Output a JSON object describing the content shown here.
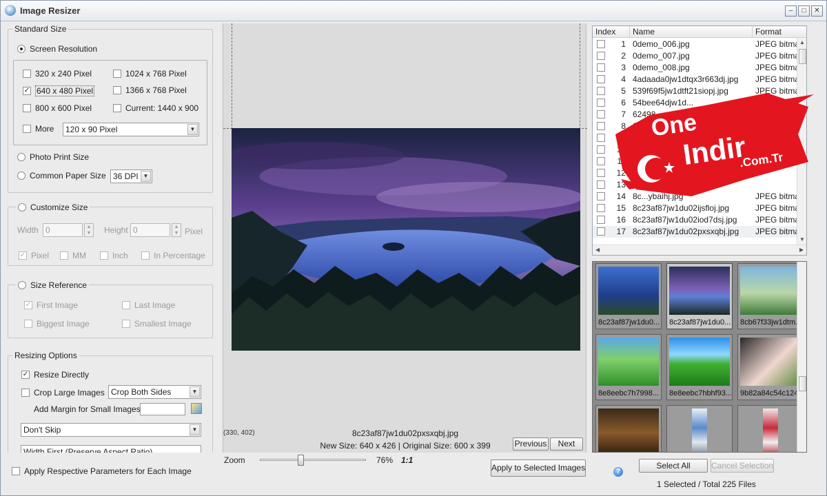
{
  "window": {
    "title": "Image Resizer",
    "controls": [
      "minimize-icon",
      "maximize-icon",
      "close-icon"
    ]
  },
  "standard_size": {
    "title": "Standard Size",
    "screen_resolution": {
      "label": "Screen Resolution",
      "selected": true
    },
    "options": [
      {
        "label": "320 x 240 Pixel",
        "checked": false
      },
      {
        "label": "1024 x 768 Pixel",
        "checked": false
      },
      {
        "label": "640 x 480 Pixel",
        "checked": true
      },
      {
        "label": "1366 x 768 Pixel",
        "checked": false
      },
      {
        "label": "800 x 600 Pixel",
        "checked": false
      },
      {
        "label": "Current: 1440 x 900",
        "checked": false
      }
    ],
    "more": {
      "label": "More",
      "checked": false,
      "value": "120 x 90 Pixel"
    },
    "photo_print": {
      "label": "Photo Print Size",
      "selected": false
    },
    "common_paper": {
      "label": "Common Paper Size",
      "selected": false,
      "dpi": "36 DPI"
    }
  },
  "customize_size": {
    "title": "Customize Size",
    "width_label": "Width",
    "width_value": "0",
    "height_label": "Height",
    "height_value": "0",
    "unit_label": "Pixel",
    "units": [
      {
        "label": "Pixel",
        "checked": true
      },
      {
        "label": "MM",
        "checked": false
      },
      {
        "label": "Inch",
        "checked": false
      },
      {
        "label": "In Percentage",
        "checked": false
      }
    ]
  },
  "size_reference": {
    "title": "Size Reference",
    "options": [
      {
        "label": "First Image",
        "checked": true
      },
      {
        "label": "Last Image",
        "checked": false
      },
      {
        "label": "Biggest Image",
        "checked": false
      },
      {
        "label": "Smallest Image",
        "checked": false
      }
    ]
  },
  "resizing_options": {
    "title": "Resizing Options",
    "resize_directly": {
      "label": "Resize Directly",
      "checked": true
    },
    "crop_large": {
      "label": "Crop Large Images",
      "checked": false,
      "mode": "Crop Both Sides"
    },
    "add_margin_label": "Add Margin for Small Images",
    "skip_mode": "Don't Skip",
    "aspect_mode": "Width First (Preserve Aspect Ratio)"
  },
  "apply_respective": {
    "label": "Apply Respective Parameters for Each Image",
    "checked": false
  },
  "preview": {
    "coords": "(330, 402)",
    "filename": "8c23af87jw1du02pxsxqbj.jpg",
    "size_info": "New Size: 640 x 426 |  Original Size: 600 x 399",
    "previous_label": "Previous",
    "next_label": "Next",
    "zoom_label": "Zoom",
    "zoom_percent": "76%",
    "zoom_value": 0.38,
    "one_to_one": "1:1",
    "apply_label": "Apply to Selected Images"
  },
  "file_list": {
    "columns": [
      "Index",
      "Name",
      "Format"
    ],
    "rows": [
      {
        "index": "1",
        "name": "0demo_006.jpg",
        "format": "JPEG bitma..."
      },
      {
        "index": "2",
        "name": "0demo_007.jpg",
        "format": "JPEG bitma..."
      },
      {
        "index": "3",
        "name": "0demo_008.jpg",
        "format": "JPEG bitma..."
      },
      {
        "index": "4",
        "name": "4adaada0jw1dtqx3r663dj.jpg",
        "format": "JPEG bitma..."
      },
      {
        "index": "5",
        "name": "539f69f5jw1dtft21siopj.jpg",
        "format": "JPEG bitma..."
      },
      {
        "index": "6",
        "name": "54bee64djw1d...",
        "format": "JPEG bitma..."
      },
      {
        "index": "7",
        "name": "62498...",
        "format": "JPEG bitma..."
      },
      {
        "index": "8",
        "name": "62...",
        "format": "JPEG bitma..."
      },
      {
        "index": "9",
        "name": "",
        "format": ""
      },
      {
        "index": "10",
        "name": "8c...",
        "format": ""
      },
      {
        "index": "11",
        "name": "",
        "format": ""
      },
      {
        "index": "12",
        "name": "",
        "format": ""
      },
      {
        "index": "13",
        "name": "",
        "format": ""
      },
      {
        "index": "14",
        "name": "8c...ybaihj.jpg",
        "format": "JPEG bitma..."
      },
      {
        "index": "15",
        "name": "8c23af87jw1du02ijsfloj.jpg",
        "format": "JPEG bitma..."
      },
      {
        "index": "16",
        "name": "8c23af87jw1du02iod7dsj.jpg",
        "format": "JPEG bitma..."
      },
      {
        "index": "17",
        "name": "8c23af87jw1du02pxsxqbj.jpg",
        "format": "JPEG bitma..."
      }
    ]
  },
  "thumbnails": [
    {
      "caption": "8c23af87jw1du0..."
    },
    {
      "caption": "8c23af87jw1du0..."
    },
    {
      "caption": "8cb67f33jw1dtm..."
    },
    {
      "caption": "8e8eebc7h7998..."
    },
    {
      "caption": "8e8eebc7hbhf93..."
    },
    {
      "caption": "9b82a84c54c124..."
    },
    {
      "caption": ""
    },
    {
      "caption": ""
    },
    {
      "caption": ""
    }
  ],
  "footer": {
    "select_all": "Select All",
    "cancel_selection": "Cancel Selection",
    "status": "1 Selected / Total 225 Files"
  },
  "watermark": {
    "line1": "One",
    "line2": "Indir",
    "line3": ".Com.Tr",
    "color": "#e3161f"
  }
}
